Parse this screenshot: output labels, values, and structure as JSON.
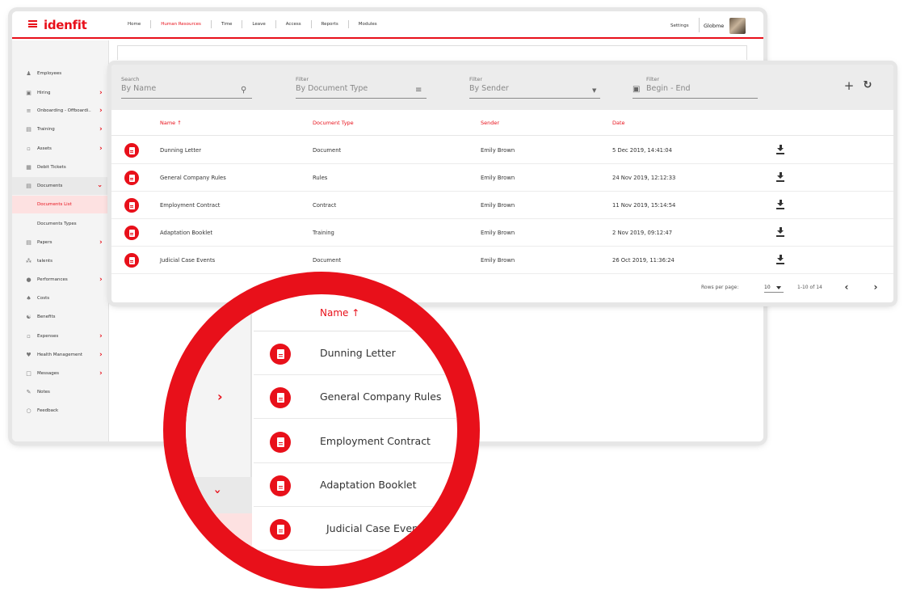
{
  "app": {
    "logo": "idenfit",
    "nav": [
      {
        "label": "Home",
        "active": false
      },
      {
        "label": "Human Resources",
        "active": true
      },
      {
        "label": "Time",
        "active": false
      },
      {
        "label": "Leave",
        "active": false
      },
      {
        "label": "Access",
        "active": false
      },
      {
        "label": "Reports",
        "active": false
      },
      {
        "label": "Modules",
        "active": false
      }
    ],
    "settings_label": "Settings",
    "user_name": "Globme"
  },
  "sidebar": {
    "items": [
      {
        "label": "Employees",
        "icon": "person-icon",
        "chevron": ""
      },
      {
        "label": "Hiring",
        "icon": "briefcase-icon",
        "chevron": "right"
      },
      {
        "label": "Onboarding - Offboardi..",
        "icon": "list-icon",
        "chevron": "right"
      },
      {
        "label": "Training",
        "icon": "board-icon",
        "chevron": "right"
      },
      {
        "label": "Assets",
        "icon": "laptop-icon",
        "chevron": "right"
      },
      {
        "label": "Debit Tickets",
        "icon": "ticket-icon",
        "chevron": ""
      },
      {
        "label": "Documents",
        "icon": "documents-icon",
        "chevron": "down",
        "state": "open"
      },
      {
        "label": "Documents List",
        "icon": "",
        "chevron": "",
        "state": "selected",
        "sub": true
      },
      {
        "label": "Documents Types",
        "icon": "",
        "chevron": "",
        "sub": true
      },
      {
        "label": "Papers",
        "icon": "paper-icon",
        "chevron": "right"
      },
      {
        "label": "talents",
        "icon": "talents-icon",
        "chevron": ""
      },
      {
        "label": "Performances",
        "icon": "circle-icon",
        "chevron": "right"
      },
      {
        "label": "Costs",
        "icon": "costs-icon",
        "chevron": ""
      },
      {
        "label": "Benefits",
        "icon": "benefits-icon",
        "chevron": ""
      },
      {
        "label": "Expenses",
        "icon": "wallet-icon",
        "chevron": "right"
      },
      {
        "label": "Health Management",
        "icon": "heart-icon",
        "chevron": "right"
      },
      {
        "label": "Messages",
        "icon": "chat-icon",
        "chevron": "right"
      },
      {
        "label": "Notes",
        "icon": "note-icon",
        "chevron": ""
      },
      {
        "label": "Feedback",
        "icon": "feedback-icon",
        "chevron": ""
      }
    ]
  },
  "filters": {
    "search": {
      "caption": "Search",
      "placeholder": "By Name"
    },
    "doc_type": {
      "caption": "Filter",
      "placeholder": "By Document Type"
    },
    "sender": {
      "caption": "Filter",
      "placeholder": "By Sender"
    },
    "date": {
      "caption": "Filter",
      "placeholder": "Begin - End"
    }
  },
  "table": {
    "columns": {
      "name": "Name",
      "type": "Document Type",
      "sender": "Sender",
      "date": "Date"
    },
    "sort_indicator": "↑",
    "rows": [
      {
        "name": "Dunning Letter",
        "type": "Document",
        "sender": "Emily Brown",
        "date": "5 Dec 2019, 14:41:04"
      },
      {
        "name": "General Company Rules",
        "type": "Rules",
        "sender": "Emily Brown",
        "date": "24 Nov 2019, 12:12:33"
      },
      {
        "name": "Employment Contract",
        "type": "Contract",
        "sender": "Emily Brown",
        "date": "11 Nov 2019, 15:14:54"
      },
      {
        "name": "Adaptation Booklet",
        "type": "Training",
        "sender": "Emily Brown",
        "date": "2 Nov 2019, 09:12:47"
      },
      {
        "name": "Judicial Case Events",
        "type": "Document",
        "sender": "Emily Brown",
        "date": "26 Oct 2019, 11:36:24"
      }
    ]
  },
  "pagination": {
    "rows_per_page_label": "Rows per page:",
    "rows_per_page": "10",
    "range": "1-10 of 14"
  },
  "magnifier": {
    "header": "Name",
    "rows": [
      "Dunning Letter",
      "General Company Rules",
      "Employment Contract",
      "Adaptation Booklet",
      "Judicial Case Events"
    ]
  },
  "colors": {
    "accent": "#e8101a",
    "filterbar": "#ececec",
    "sidebar": "#f4f4f4",
    "selected": "#fde1e1"
  }
}
